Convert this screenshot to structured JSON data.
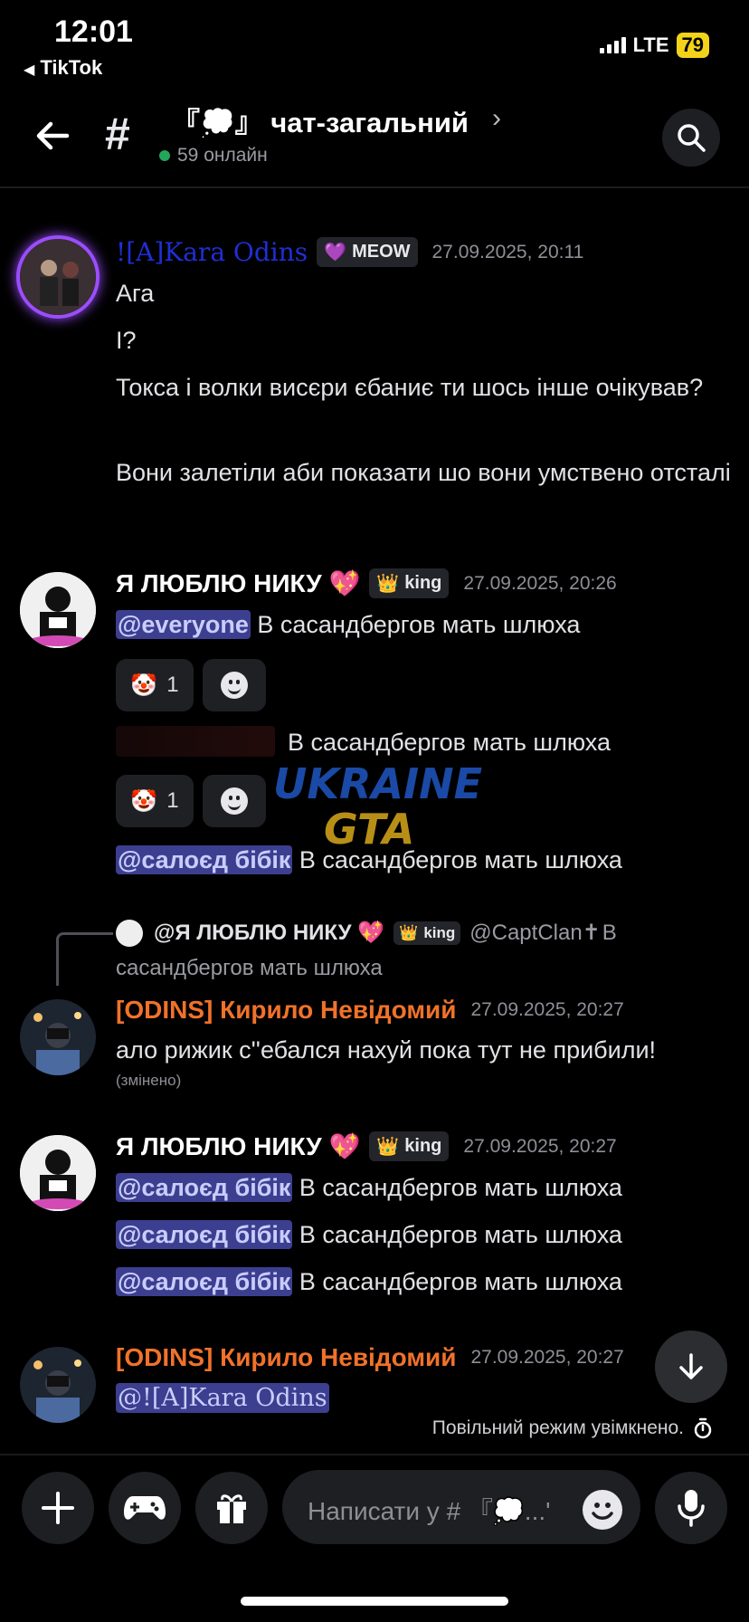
{
  "status_bar": {
    "time": "12:01",
    "back_app": "TikTok",
    "network": "LTE",
    "battery": "79"
  },
  "header": {
    "channel": "『💭』 чат-загальний",
    "online": "59 онлайн"
  },
  "messages": [
    {
      "author": "![A]Kara Odins",
      "tag": "MEOW",
      "time": "27.09.2025, 20:11",
      "lines": [
        "Ага",
        "І?",
        "Токса і волки висєри єбаниє ти шось інше очікував?",
        "Вони залетіли аби показати шо вони умствено отсталі"
      ]
    },
    {
      "author": "Я ЛЮБЛЮ НИКУ 💖",
      "tag": "king",
      "time": "27.09.2025, 20:26",
      "line1_mention": "@everyone",
      "line1_text": " В сасандбергов мать шлюха",
      "reaction1_count": "1",
      "line2_text": "В сасандбергов мать шлюха",
      "reaction2_count": "1",
      "line3_mention": "@салоєд бібік",
      "line3_text": " В сасандбергов мать шлюха"
    },
    {
      "reply_author": "@Я ЛЮБЛЮ НИКУ 💖",
      "reply_tag": "king",
      "reply_mention": "@CaptClan✝",
      "reply_text_a": " В",
      "reply_text_b": "сасандбергов мать шлюха",
      "author": "[ODINS] Кирило Невідомий",
      "time": "27.09.2025, 20:27",
      "text": "ало рижик с''ебался нахуй пока тут не прибили!",
      "edited": "(змінено)"
    },
    {
      "author": "Я ЛЮБЛЮ НИКУ 💖",
      "tag": "king",
      "time": "27.09.2025, 20:27",
      "lines": [
        {
          "mention": "@салоєд бібік",
          "text": " В сасандбергов мать шлюха"
        },
        {
          "mention": "@салоєд бібік",
          "text": " В сасандбергов мать шлюха"
        },
        {
          "mention": "@салоєд бібік",
          "text": " В сасандбергов мать шлюха"
        }
      ]
    },
    {
      "author": "[ODINS] Кирило Невідомий",
      "time": "27.09.2025, 20:27",
      "mention": "@![A]Kara Odins"
    }
  ],
  "watermark": {
    "line1": "UKRAINE",
    "line2": "GTA"
  },
  "slow_mode": "Повільний режим увімкнено.",
  "composer": {
    "placeholder": "Написати у # 『💭...'"
  },
  "colors": {
    "odins_orange": "#f0722a",
    "kara_blue": "#1f2fd6",
    "online_green": "#23a55a",
    "mention_bg": "#3c3f8f"
  }
}
